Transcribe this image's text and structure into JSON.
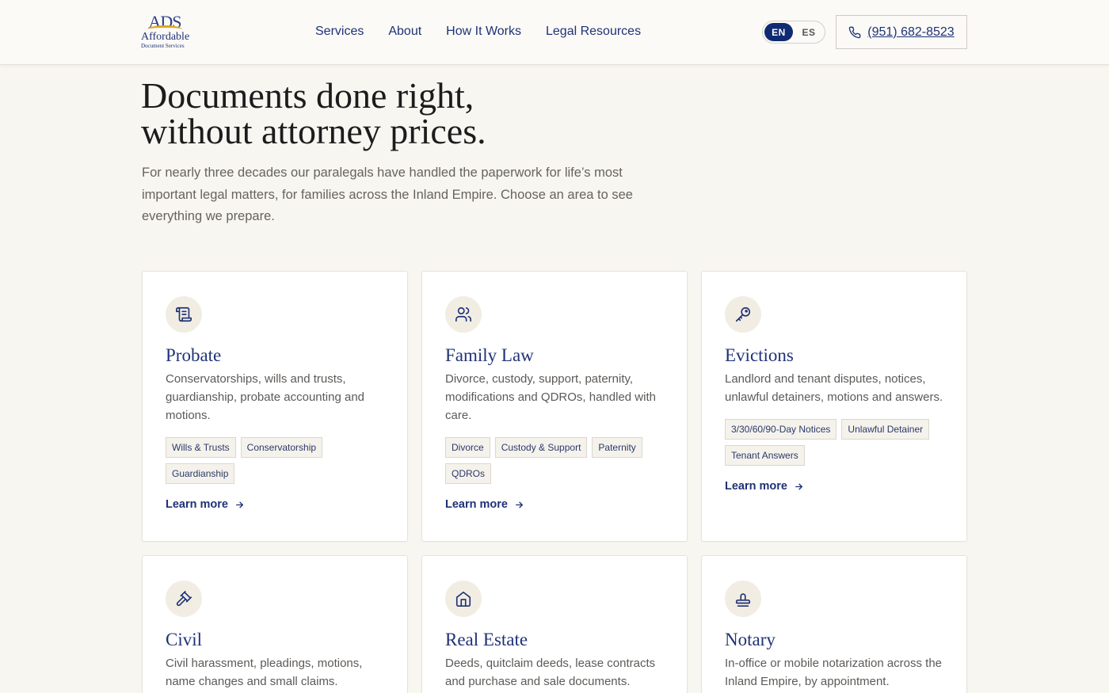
{
  "brand": {
    "monogram": "ADS",
    "name": "Affordable",
    "tagline": "Document Services"
  },
  "nav": {
    "items": [
      "Services",
      "About",
      "How It Works",
      "Legal Resources"
    ]
  },
  "lang": {
    "active": "EN",
    "inactive": "ES"
  },
  "phone": {
    "label": "(951) 682-8523",
    "icon": "phone-icon"
  },
  "hero": {
    "title_line1": "Documents done right,",
    "title_line2": "without attorney prices.",
    "text": "For nearly three decades our paralegals have handled the paperwork for life’s most important legal matters, for families across the Inland Empire. Choose an area to see everything we prepare."
  },
  "services": [
    {
      "icon": "scroll-icon",
      "title": "Probate",
      "desc": "Conservatorships, wills and trusts, guardianship, probate accounting and motions.",
      "tags": [
        "Wills & Trusts",
        "Conservatorship",
        "Guardianship"
      ],
      "link": "Learn more"
    },
    {
      "icon": "users-icon",
      "title": "Family Law",
      "desc": "Divorce, custody, support, paternity, modifications and QDROs, handled with care.",
      "tags": [
        "Divorce",
        "Custody & Support",
        "Paternity",
        "QDROs"
      ],
      "link": "Learn more"
    },
    {
      "icon": "key-icon",
      "title": "Evictions",
      "desc": "Landlord and tenant disputes, notices, unlawful detainers, motions and answers.",
      "tags": [
        "3/30/60/90-Day Notices",
        "Unlawful Detainer",
        "Tenant Answers"
      ],
      "link": "Learn more"
    },
    {
      "icon": "gavel-icon",
      "title": "Civil",
      "desc": "Civil harassment, pleadings, motions, name changes and small claims."
    },
    {
      "icon": "house-icon",
      "title": "Real Estate",
      "desc": "Deeds, quitclaim deeds, lease contracts and purchase and sale documents."
    },
    {
      "icon": "stamp-icon",
      "title": "Notary",
      "desc": "In-office or mobile notarization across the Inland Empire, by appointment."
    }
  ],
  "colors": {
    "navy": "#1f3276",
    "background": "#f8f6f1",
    "gold": "#e0a722"
  }
}
